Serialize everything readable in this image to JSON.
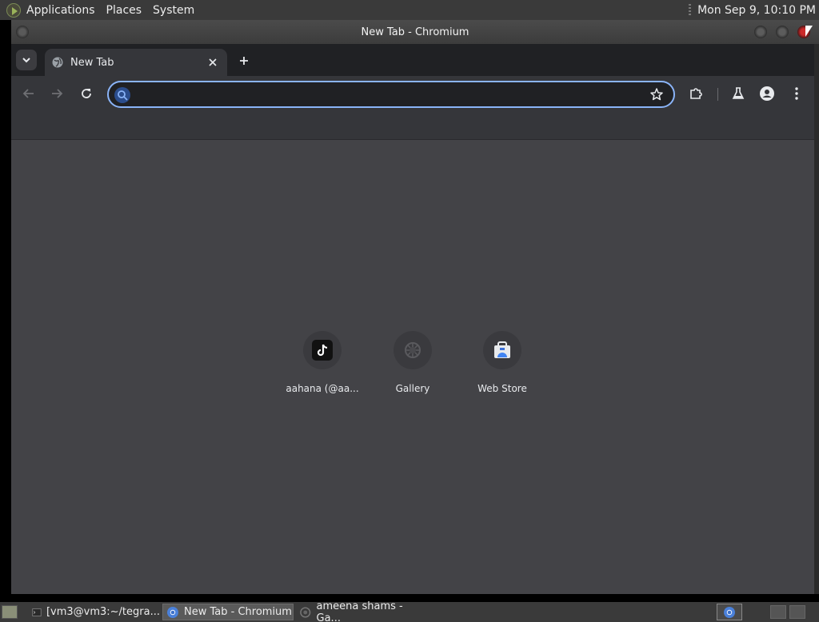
{
  "top_panel": {
    "menus": [
      "Applications",
      "Places",
      "System"
    ],
    "clock": "Mon Sep  9, 10:10 PM"
  },
  "window": {
    "title": "New Tab - Chromium"
  },
  "browser": {
    "tab": {
      "title": "New Tab",
      "icon": "globe-icon"
    },
    "omnibox": {
      "value": "",
      "placeholder": ""
    },
    "accent_color": "#8ab4f8",
    "shortcuts": [
      {
        "label": "aahana (@aa...",
        "icon": "tiktok-icon"
      },
      {
        "label": "Gallery",
        "icon": "gallery-icon"
      },
      {
        "label": "Web Store",
        "icon": "web-store-icon"
      }
    ]
  },
  "taskbar": {
    "tasks": [
      {
        "label": "[vm3@vm3:~/tegra...",
        "icon": "terminal-icon"
      },
      {
        "label": "New Tab - Chromium",
        "icon": "chromium-icon",
        "active": true
      },
      {
        "label": "ameena shams - Ga...",
        "icon": "gallery-icon"
      }
    ]
  }
}
